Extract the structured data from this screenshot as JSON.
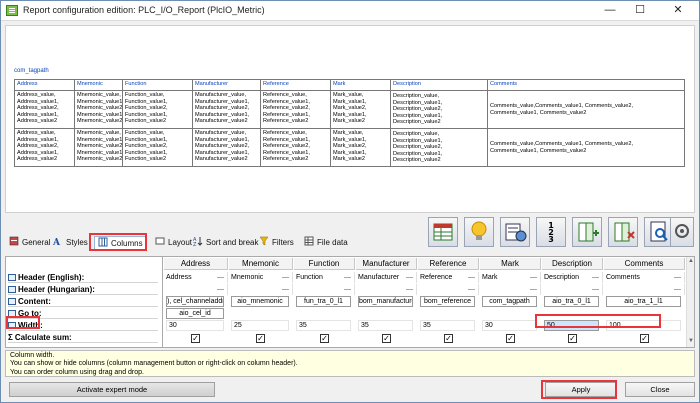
{
  "window": {
    "title": "Report configuration edition: PLC_I/O_Report (PlcIO_Metric)",
    "minimize": "—",
    "maximize": "☐",
    "close": "✕"
  },
  "preview": {
    "caption": "com_tagpath",
    "headers": [
      "Address",
      "Mnemonic",
      "Function",
      "Manufacturer",
      "Reference",
      "Mark",
      "Description",
      "Comments"
    ],
    "rows": [
      {
        "address": [
          "Address_value,",
          "Address_value1,",
          "Address_value2,",
          "Address_value1,",
          "Address_value2"
        ],
        "mnemonic": [
          "Mnemonic_value,",
          "Mnemonic_value1,",
          "Mnemonic_value2,",
          "Mnemonic_value1,",
          "Mnemonic_value2"
        ],
        "function": [
          "Function_value,",
          "Function_value1,",
          "Function_value2,",
          "Function_value1,",
          "Function_value2"
        ],
        "manufacturer": [
          "Manufacturer_value,",
          "Manufacturer_value1,",
          "Manufacturer_value2,",
          "Manufacturer_value1,",
          "Manufacturer_value2"
        ],
        "reference": [
          "Reference_value,",
          "Reference_value1,",
          "Reference_value2,",
          "Reference_value1,",
          "Reference_value2"
        ],
        "mark": [
          "Mark_value,",
          "Mark_value1,",
          "Mark_value2,",
          "Mark_value1,",
          "Mark_value2"
        ],
        "description": "Description_value, Description_value1, Description_value2, Description_value1, Description_value2",
        "comments": "Comments_value,Comments_value1, Comments_value2, Comments_value1, Comments_value2"
      },
      {
        "address": [
          "Address_value,",
          "Address_value1,",
          "Address_value2,",
          "Address_value1,",
          "Address_value2"
        ],
        "mnemonic": [
          "Mnemonic_value,",
          "Mnemonic_value1,",
          "Mnemonic_value2,",
          "Mnemonic_value1,",
          "Mnemonic_value2"
        ],
        "function": [
          "Function_value,",
          "Function_value1,",
          "Function_value2,",
          "Function_value1,",
          "Function_value2"
        ],
        "manufacturer": [
          "Manufacturer_value,",
          "Manufacturer_value1,",
          "Manufacturer_value2,",
          "Manufacturer_value1,",
          "Manufacturer_value2"
        ],
        "reference": [
          "Reference_value,",
          "Reference_value1,",
          "Reference_value2,",
          "Reference_value1,",
          "Reference_value2"
        ],
        "mark": [
          "Mark_value,",
          "Mark_value1,",
          "Mark_value2,",
          "Mark_value1,",
          "Mark_value2"
        ],
        "description": "Description_value, Description_value1, Description_value2, Description_value1, Description_value2",
        "comments": "Comments_value,Comments_value1, Comments_value2, Comments_value1, Comments_value2"
      }
    ]
  },
  "toolbar_icons": [
    "table-view-icon",
    "lightbulb-icon",
    "column-settings-icon",
    "sort-123-icon",
    "add-column-icon",
    "remove-column-icon",
    "preview-search-icon",
    "expert-tools-icon"
  ],
  "tabs": [
    {
      "label": "General",
      "icon": "general-icon",
      "active": false
    },
    {
      "label": "Styles",
      "icon": "styles-icon",
      "active": false
    },
    {
      "label": "Columns",
      "icon": "columns-icon",
      "active": true
    },
    {
      "label": "Layout",
      "icon": "layout-icon",
      "active": false
    },
    {
      "label": "Sort and break",
      "icon": "sort-icon",
      "active": false
    },
    {
      "label": "Filters",
      "icon": "filter-icon",
      "active": false
    },
    {
      "label": "File data",
      "icon": "file-data-icon",
      "active": false
    }
  ],
  "grid": {
    "row_labels": {
      "header_en": "Header (English):",
      "header_hu": "Header (Hungarian):",
      "content": "Content:",
      "goto": "Go to:",
      "width": "Width:",
      "calc_sum": "Calculate sum:"
    },
    "columns": [
      {
        "name": "Address",
        "header_en": "Address",
        "content": "), cel_channeladdres",
        "goto": "aio_cel_id",
        "width": "30"
      },
      {
        "name": "Mnemonic",
        "header_en": "Mnemonic",
        "content": "aio_mnemonic",
        "goto": "",
        "width": "25"
      },
      {
        "name": "Function",
        "header_en": "Function",
        "content": "fun_tra_0_l1",
        "goto": "",
        "width": "35"
      },
      {
        "name": "Manufacturer",
        "header_en": "Manufacturer",
        "content": "bom_manufacturer",
        "goto": "",
        "width": "35"
      },
      {
        "name": "Reference",
        "header_en": "Reference",
        "content": "bom_reference",
        "goto": "",
        "width": "35"
      },
      {
        "name": "Mark",
        "header_en": "Mark",
        "content": "com_tagpath",
        "goto": "",
        "width": "30"
      },
      {
        "name": "Description",
        "header_en": "Description",
        "content": "aio_tra_0_l1",
        "goto": "",
        "width": "50"
      },
      {
        "name": "Comments",
        "header_en": "Comments",
        "content": "aio_tra_1_l1",
        "goto": "",
        "width": "100"
      }
    ],
    "dash": "—",
    "check": "✓"
  },
  "info": {
    "lines": [
      "Column width.",
      "You can show or hide columns (column management button or right-click on column header).",
      "You can order column using drag and drop."
    ]
  },
  "buttons": {
    "expert": "Activate expert mode",
    "apply": "Apply",
    "close": "Close"
  },
  "colors": {
    "highlight": "#e8353a",
    "link_blue": "#0a44b9"
  }
}
